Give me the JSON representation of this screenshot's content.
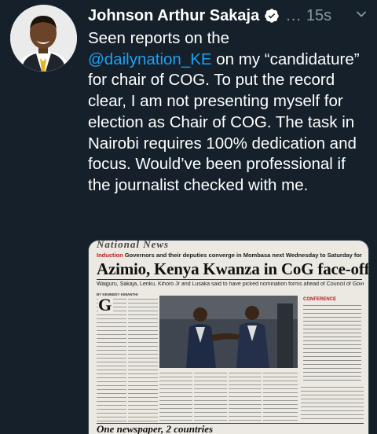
{
  "tweet": {
    "author_name": "Johnson Arthur Sakaja",
    "handle": "...",
    "time": "15s",
    "text_before": "Seen reports on the",
    "mention": "@dailynation_KE",
    "text_after": " on my “candidature” for chair of COG. To put the record clear, I am not presenting myself for election as Chair of COG. The task in Nairobi requires 100% dedication and focus. Would’ve been professional if the journalist checked with me."
  },
  "icons": {
    "avatar": "profile-photo",
    "verified": "verified-badge-icon",
    "more": "chevron-down-icon"
  },
  "colors": {
    "background": "#15202b",
    "text": "#ffffff",
    "secondary": "#8899a6",
    "link": "#1da1f2"
  },
  "media": {
    "masthead": "National News",
    "kicker_tag": "Induction",
    "kicker_text": " Governors and their deputies converge in Mombasa next Wednesday to Saturday for a conference",
    "headline": "Azimio, Kenya Kwanza in CoG face-off",
    "standfirst": "Waiguru, Sakaja, Lenku, Kihoro Jr and Lusaka said to have picked nomination forms ahead of Council of Governors chairperson race",
    "byline": "BY KENNEDY KIMANTHI",
    "dropcap": "G",
    "caption_title": "CONFERENCE",
    "bottom_banner": "One newspaper, 2 countries"
  }
}
